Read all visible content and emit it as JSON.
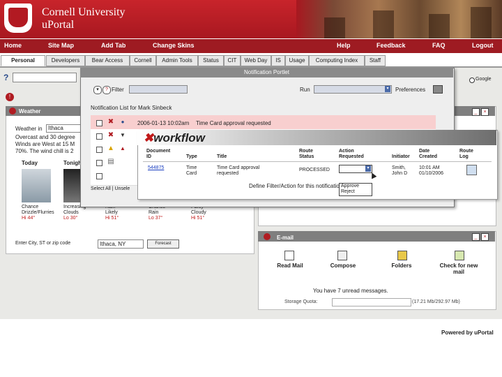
{
  "header": {
    "brand_line1": "Cornell University",
    "brand_line2": "uPortal"
  },
  "nav": {
    "home": "Home",
    "site_map": "Site Map",
    "add_tab": "Add Tab",
    "change_skins": "Change Skins",
    "help": "Help",
    "feedback": "Feedback",
    "faq": "FAQ",
    "logout": "Logout"
  },
  "tabs": [
    "Personal",
    "Developers",
    "Bear Access",
    "Cornell",
    "Admin Tools",
    "Status",
    "CIT",
    "Web Day",
    "IS",
    "Usage",
    "Computing Index",
    "Staff"
  ],
  "search": {
    "google_label": "Google"
  },
  "weather": {
    "title": "Weather",
    "weather_in_label": "Weather in",
    "city_value": "Ithaca",
    "desc_line1": "Overcast and 30 degree",
    "desc_line2": "Winds are West at 15 M",
    "desc_line3": "70%. The wind chill is 2",
    "today": "Today",
    "tonight": "Tonigh",
    "cols": [
      {
        "line1": "Chance",
        "line2": "Drizzle/Flurries",
        "temp": "Hi 44°"
      },
      {
        "line1": "Increasing",
        "line2": "Clouds",
        "temp": "Lo 30°"
      },
      {
        "line1": "Rain",
        "line2": "Likely",
        "temp": "Hi 51°"
      },
      {
        "line1": "Chance",
        "line2": "Rain",
        "temp": "Lo 37°"
      },
      {
        "line1": "Partly",
        "line2": "Cloudy",
        "temp": "Hi 51°"
      }
    ],
    "zip_label": "Enter City, ST or zip code",
    "zip_value": "Ithaca, NY",
    "forecast_button": "Forecast"
  },
  "email": {
    "title": "E-mail",
    "read_mail": "Read Mail",
    "compose": "Compose",
    "folders": "Folders",
    "check_line1": "Check for new",
    "check_line2": "mail",
    "unread_text": "You have 7 unread messages.",
    "storage_label": "Storage Quota:",
    "storage_value": "(17.21 Mb/292.97 Mb)"
  },
  "footer": {
    "powered_by": "Powered by uPortal"
  },
  "notification": {
    "title": "Notification Portlet",
    "filter_label": "Filter",
    "run_label": "Run",
    "preferences_label": "Preferences",
    "list_title": "Notification List for Mark Sinbeck",
    "row1_date": "2006-01-13 10:02am",
    "row1_text": "Time Card approval requested",
    "select_all": "Select All | Unsele"
  },
  "workflow": {
    "logo_prefix": "✖",
    "logo_text": "workflow",
    "headers": {
      "doc_id_1": "Document",
      "doc_id_2": "ID",
      "type": "Type",
      "title": "Title",
      "route_1": "Route",
      "route_2": "Status",
      "action_1": "Action",
      "action_2": "Requested",
      "initiator": "Initiator",
      "date_1": "Date",
      "date_2": "Created",
      "log_1": "Route",
      "log_2": "Log"
    },
    "row": {
      "doc_id": "544875",
      "type_1": "Time",
      "type_2": "Card",
      "title_1": "Time Card approval",
      "title_2": "requested",
      "status": "PROCESSED",
      "initiator_1": "Smith,",
      "initiator_2": "John D",
      "date_1": "10:01 AM",
      "date_2": "01/10/2006"
    },
    "action_options": [
      "Approve",
      "Reject"
    ],
    "define_filter": "Define Filter/Action for this notification"
  }
}
